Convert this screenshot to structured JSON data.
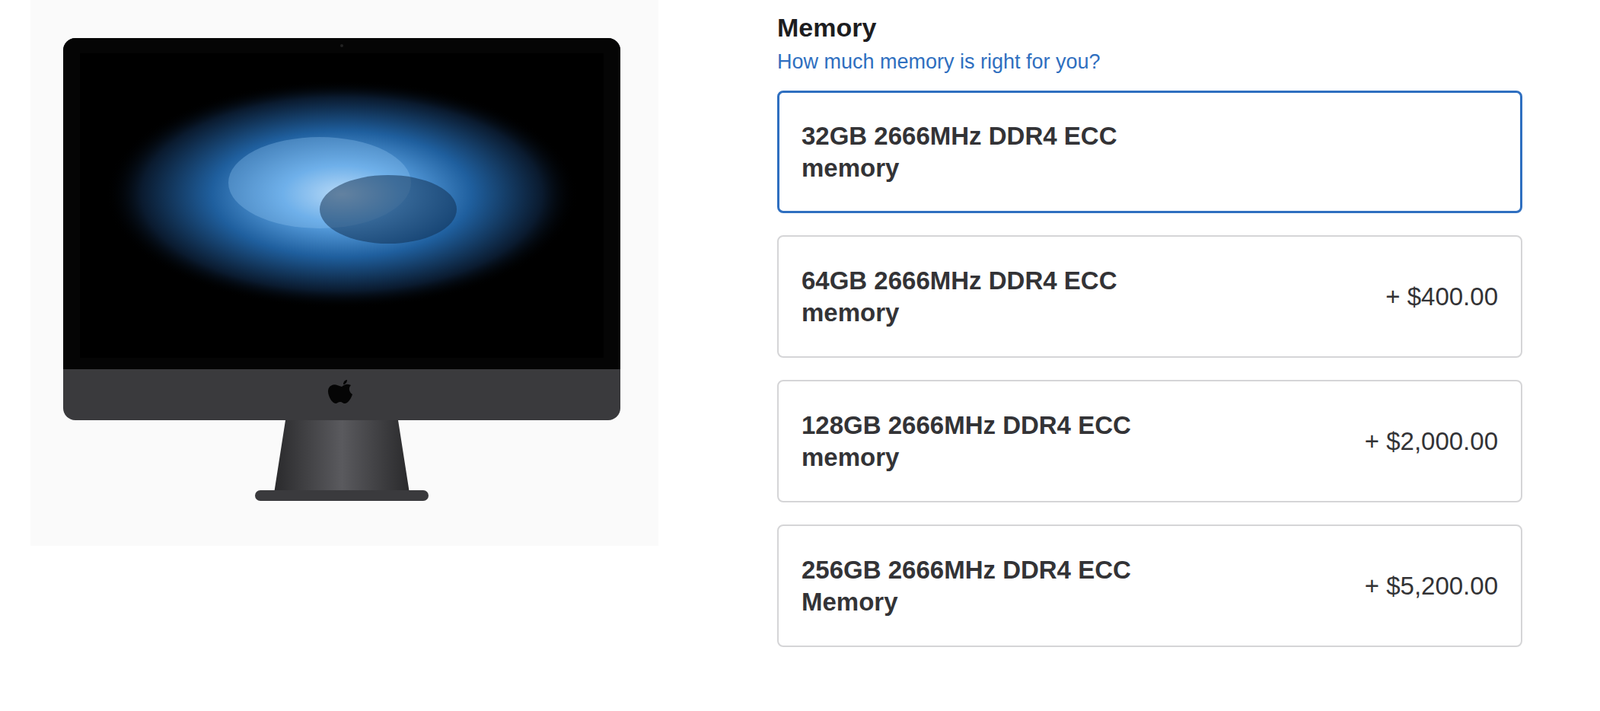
{
  "memory": {
    "title": "Memory",
    "help_link": "How much memory is right for you?",
    "options": [
      {
        "label": "32GB 2666MHz DDR4 ECC memory",
        "price": "",
        "selected": true
      },
      {
        "label": "64GB 2666MHz DDR4 ECC memory",
        "price": "+ $400.00",
        "selected": false
      },
      {
        "label": "128GB 2666MHz DDR4 ECC memory",
        "price": "+ $2,000.00",
        "selected": false
      },
      {
        "label": "256GB 2666MHz DDR4 ECC Memory",
        "price": "+ $5,200.00",
        "selected": false
      }
    ]
  }
}
